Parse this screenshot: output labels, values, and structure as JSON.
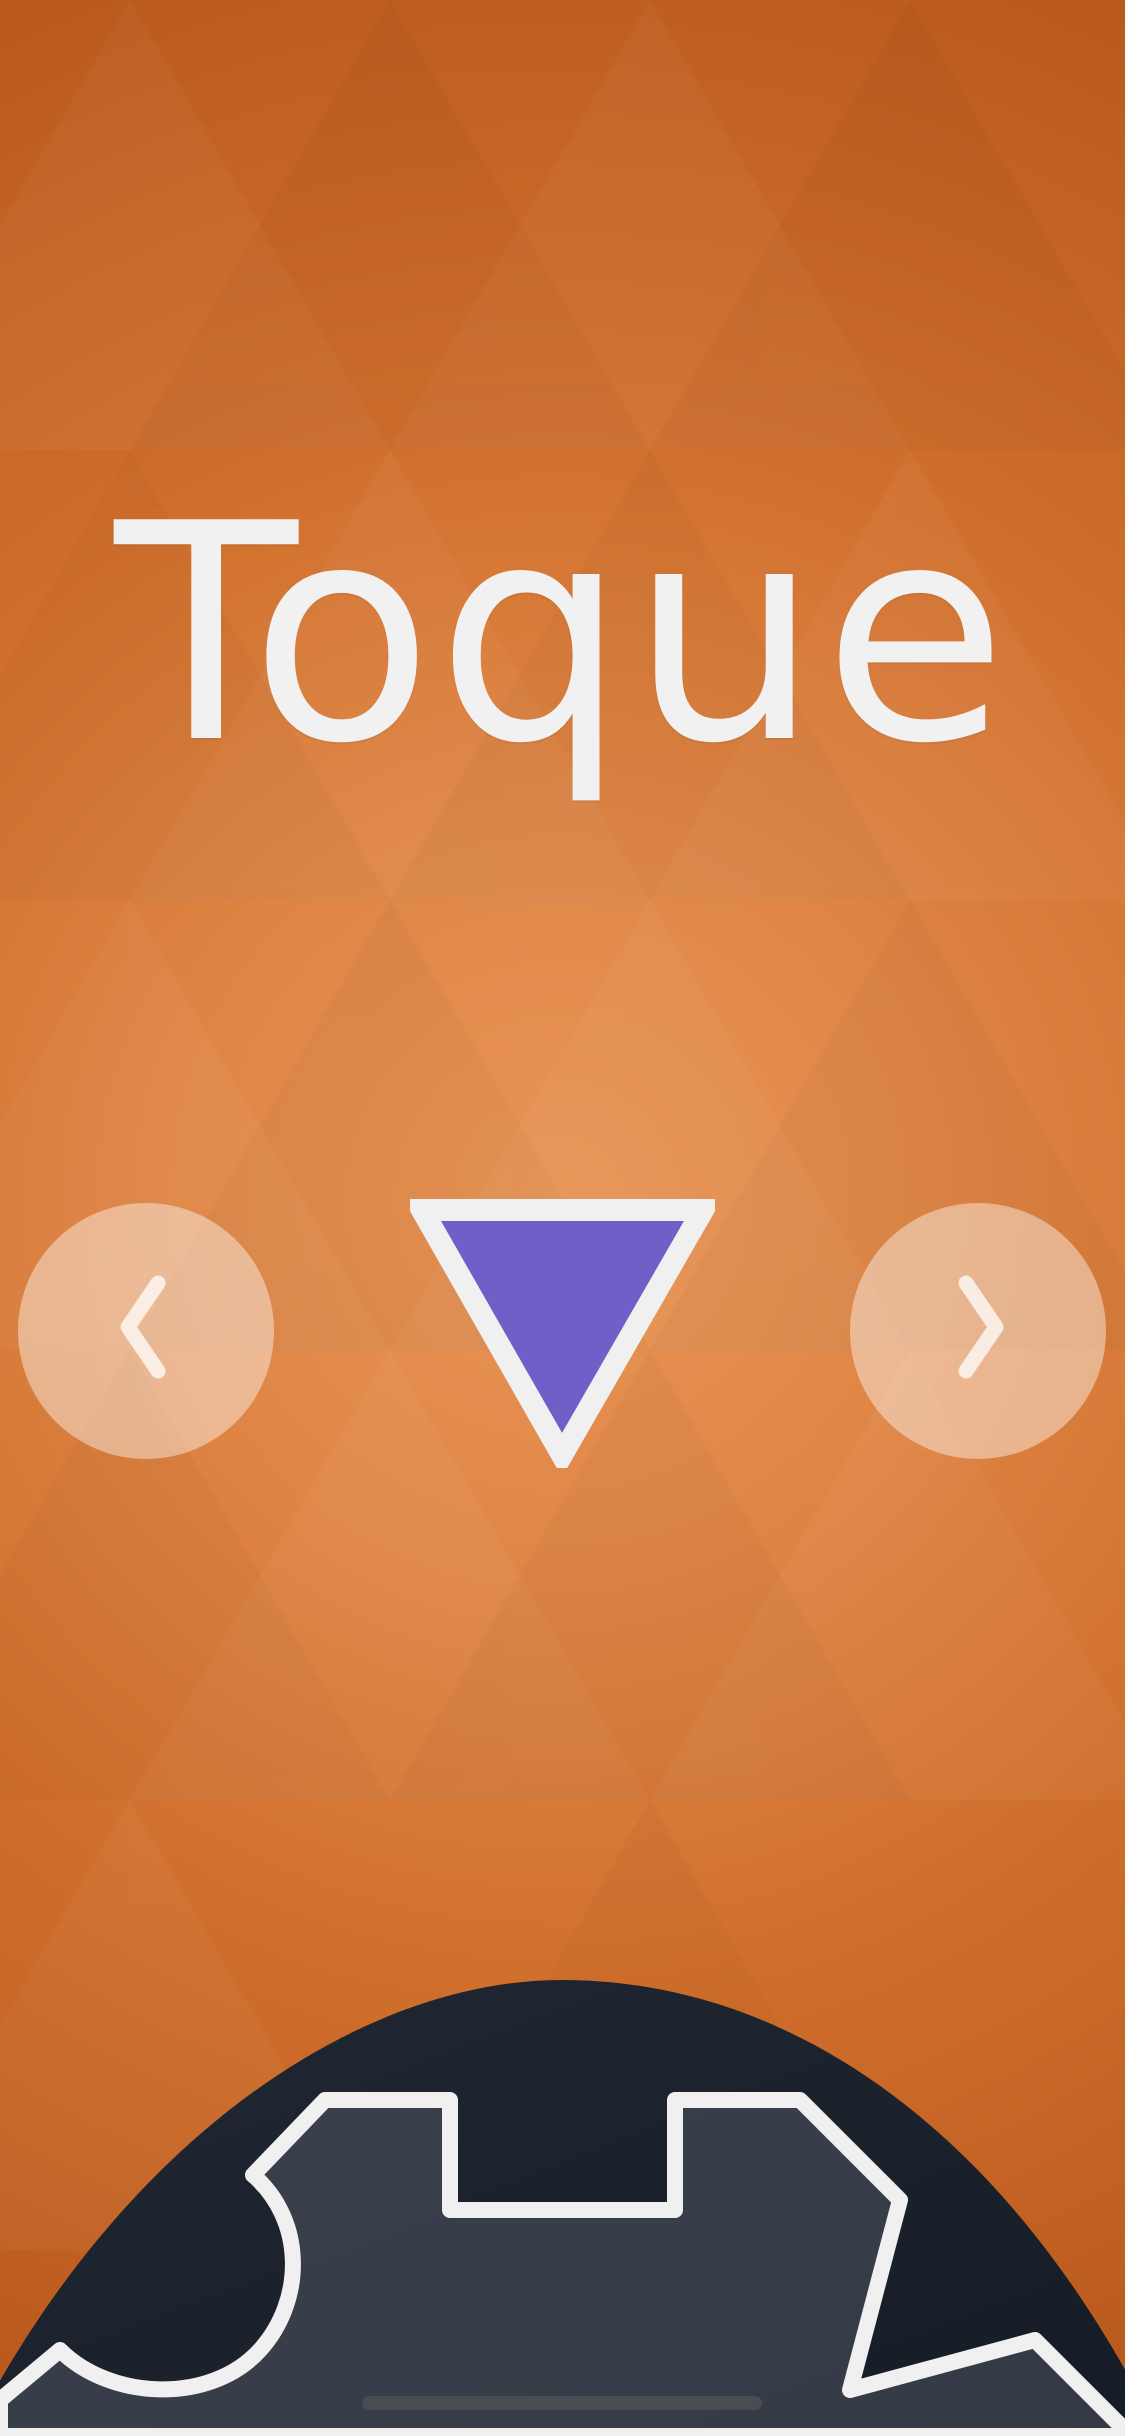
{
  "title": "Toque",
  "nav": {
    "previous_icon": "chevron-left-icon",
    "next_icon": "chevron-right-icon"
  },
  "shape": {
    "kind": "triangle-down",
    "fill": "#6f60c8",
    "stroke": "#f0f0f0"
  },
  "colors": {
    "background_center": "#e99557",
    "background_edge": "#b7571b",
    "panel": "#1f2430",
    "outline": "#f0f0f0"
  }
}
